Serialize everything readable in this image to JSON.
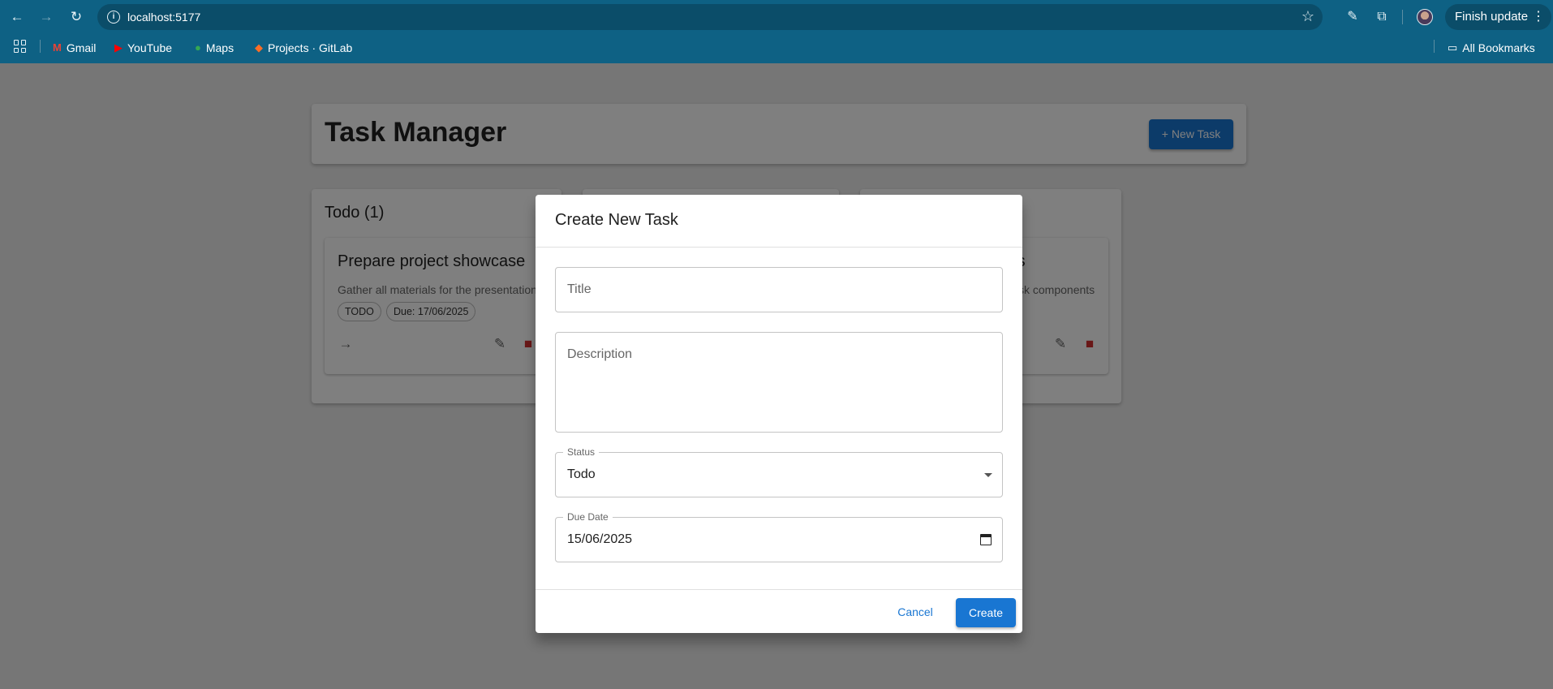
{
  "browser": {
    "url": "localhost:5177",
    "finish_update_label": "Finish update",
    "bookmarks": [
      {
        "label": "Gmail",
        "icon": "gmail-icon"
      },
      {
        "label": "YouTube",
        "icon": "youtube-icon"
      },
      {
        "label": "Maps",
        "icon": "maps-icon"
      },
      {
        "label": "Projects · GitLab",
        "icon": "gitlab-icon"
      }
    ],
    "all_bookmarks_label": "All Bookmarks"
  },
  "header": {
    "title": "Task Manager",
    "new_task_label": "+ New Task"
  },
  "columns": [
    {
      "title": "Todo (1)",
      "tasks": [
        {
          "title": "Prepare project showcase",
          "description": "Gather all materials for the presentation",
          "status_chip": "TODO",
          "due_chip": "Due: 17/06/2025"
        }
      ]
    },
    {
      "title": "",
      "tasks": []
    },
    {
      "title": "",
      "tasks": [
        {
          "title": "rs",
          "description": "sk components"
        }
      ]
    }
  ],
  "dialog": {
    "title": "Create New Task",
    "title_placeholder": "Title",
    "description_placeholder": "Description",
    "status_label": "Status",
    "status_value": "Todo",
    "due_date_label": "Due Date",
    "due_date_value": "15/06/2025",
    "cancel_label": "Cancel",
    "create_label": "Create"
  },
  "colors": {
    "browser_chrome": "#0e6184",
    "primary": "#1976d2",
    "delete_red": "#d32f2f"
  }
}
